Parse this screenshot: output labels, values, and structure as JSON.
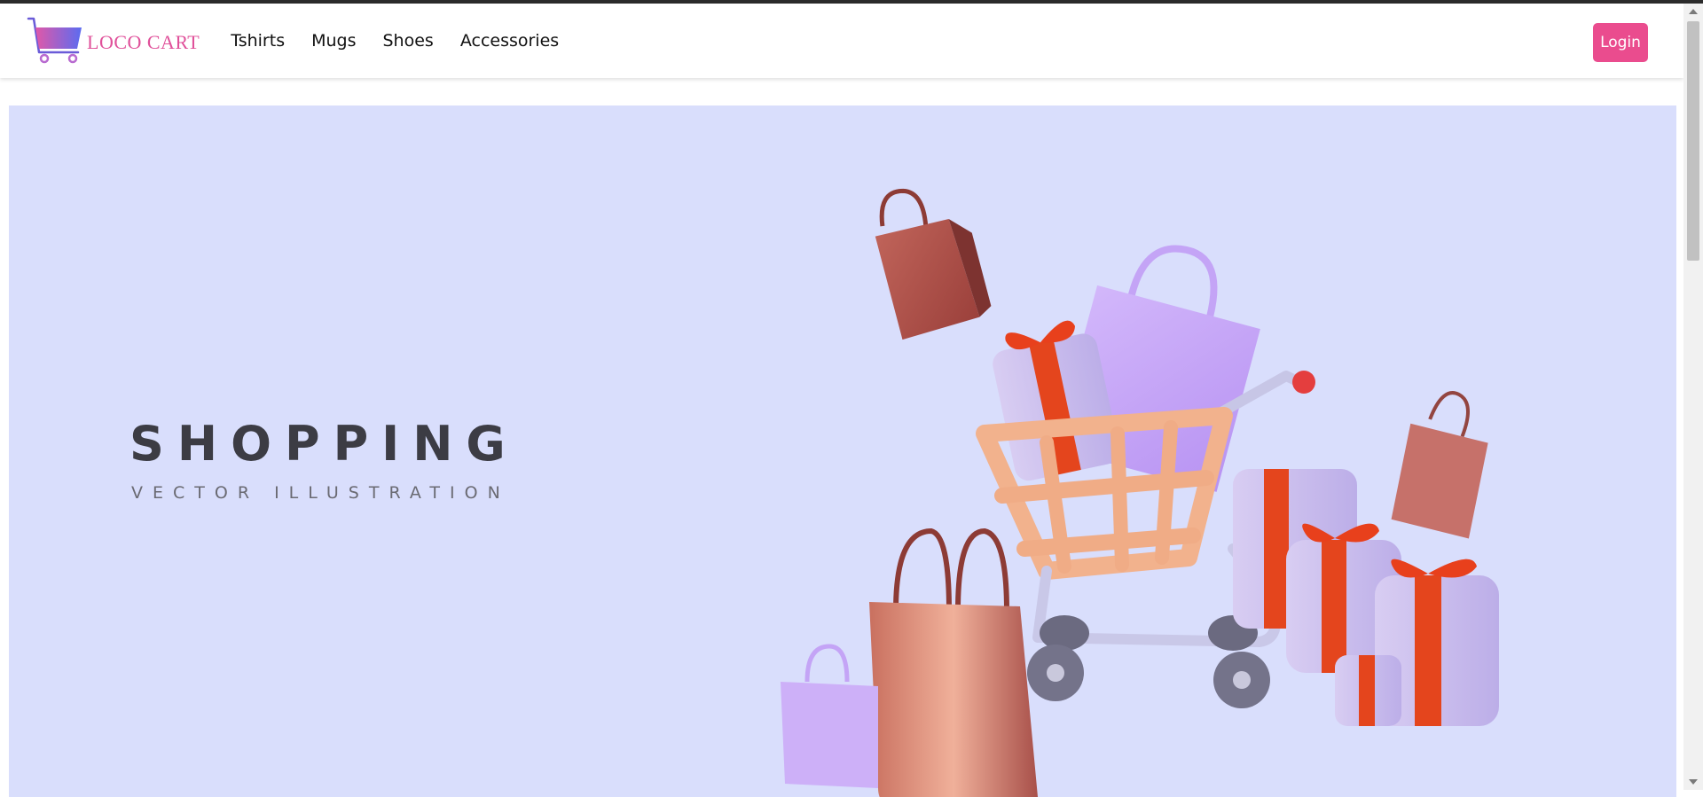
{
  "brand": {
    "name": "LOCO CART",
    "logo_icon": "shopping-cart-logo"
  },
  "nav": {
    "items": [
      {
        "label": "Tshirts"
      },
      {
        "label": "Mugs"
      },
      {
        "label": "Shoes"
      },
      {
        "label": "Accessories"
      }
    ]
  },
  "header": {
    "login_label": "Login"
  },
  "hero": {
    "title": "SHOPPING",
    "subtitle": "VECTOR ILLUSTRATION",
    "illustration": "shopping-cart-with-bags-and-gifts"
  },
  "colors": {
    "brand_pink": "#ea4c8e",
    "hero_background": "#d9defc",
    "bag_brown": "#b5544d",
    "bag_lilac": "#c8a8f5",
    "cart_peach": "#f3b691",
    "gift_ribbon": "#e8401c"
  }
}
